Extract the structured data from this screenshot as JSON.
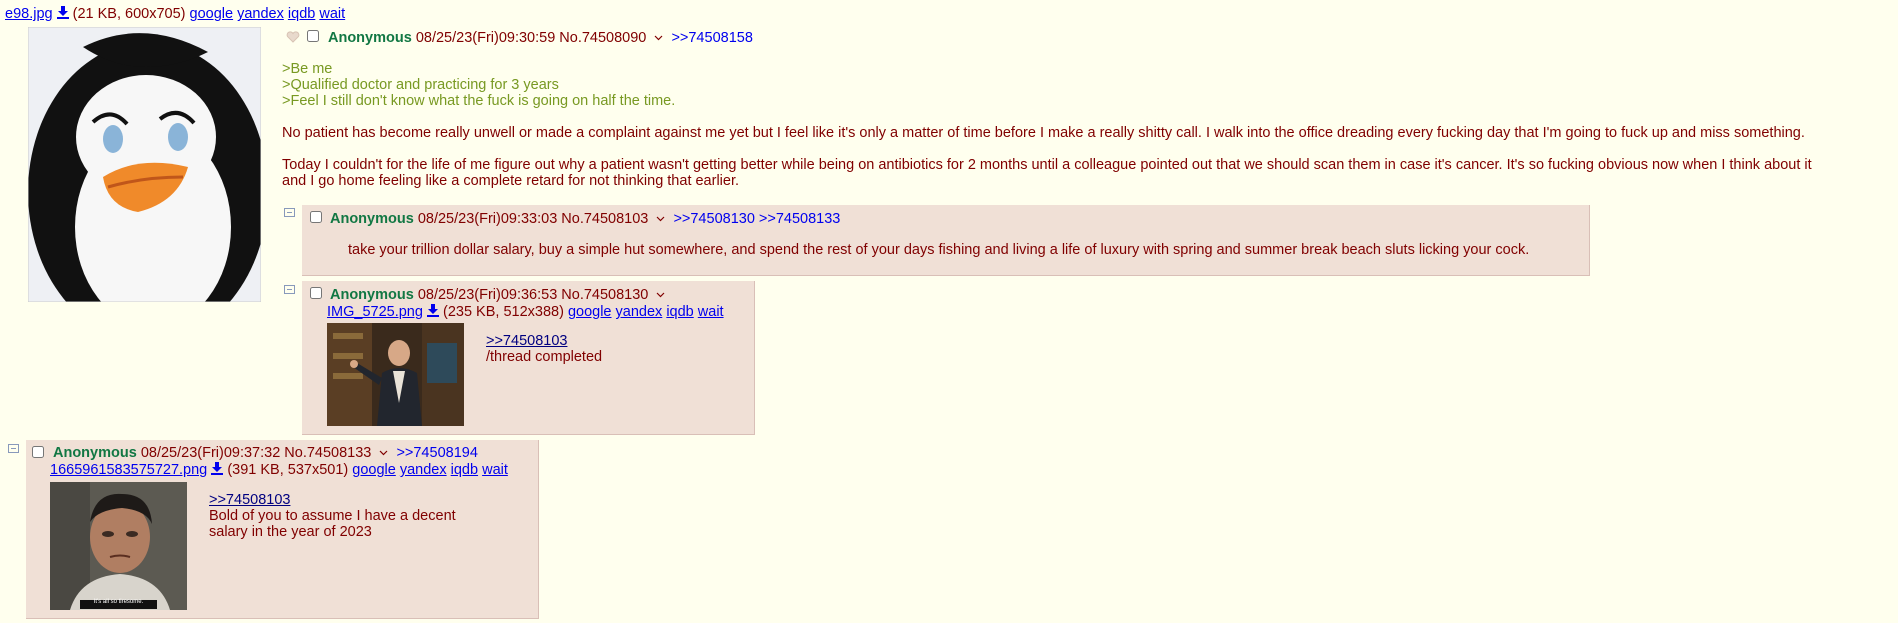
{
  "op": {
    "file": {
      "name": "e98.jpg",
      "info": "(21 KB, 600x705)"
    },
    "search_links": {
      "google": "google",
      "yandex": "yandex",
      "iqdb": "iqdb",
      "wait": "wait"
    },
    "name": "Anonymous",
    "datetime": "08/25/23(Fri)09:30:59",
    "post_no": "No.74508090",
    "backlinks": [
      ">>74508158"
    ],
    "quotes": [
      ">Be me",
      ">Qualified doctor and practicing for 3 years",
      ">Feel I still don't know what the fuck is going on half the time."
    ],
    "para1": "No patient has become really unwell or made a complaint against me yet but I feel like it's only a matter of time before I make a really shitty call. I walk into the office dreading every fucking day that I'm going to fuck up and miss something.",
    "para2_line1": "Today I couldn't for the life of me figure out why a patient wasn't getting better while being on antibiotics for 2 months until a colleague pointed out that we should scan them in case it's cancer. It's so fucking obvious now when I think about it",
    "para2_line2": "and I go home feeling like a complete retard for not thinking that earlier."
  },
  "reply1": {
    "name": "Anonymous",
    "datetime": "08/25/23(Fri)09:33:03",
    "post_no": "No.74508103",
    "backlinks": [
      ">>74508130",
      ">>74508133"
    ],
    "text": "take your trillion dollar salary, buy a simple hut somewhere, and spend the rest of your days fishing and living a life of luxury with spring and summer break beach sluts licking your cock."
  },
  "reply2": {
    "name": "Anonymous",
    "datetime": "08/25/23(Fri)09:36:53",
    "post_no": "No.74508130",
    "file": {
      "name": "IMG_5725.png",
      "info": "(235 KB, 512x388)"
    },
    "search_links": {
      "google": "google",
      "yandex": "yandex",
      "iqdb": "iqdb",
      "wait": "wait"
    },
    "quote_link": ">>74508103",
    "text": "/thread completed"
  },
  "reply3": {
    "name": "Anonymous",
    "datetime": "08/25/23(Fri)09:37:32",
    "post_no": "No.74508133",
    "backlinks": [
      ">>74508194"
    ],
    "file": {
      "name": "1665961583575727.png",
      "info": "(391 KB, 537x501)"
    },
    "search_links": {
      "google": "google",
      "yandex": "yandex",
      "iqdb": "iqdb",
      "wait": "wait"
    },
    "quote_link": ">>74508103",
    "text_line1": "Bold of you to assume I have a decent",
    "text_line2": "salary in the year of 2023",
    "thumb_caption": "It's all so tiresome."
  },
  "colors": {
    "background": "#ffffee",
    "reply_bg": "#f0e0d6",
    "name": "#117743",
    "greentext": "#789922",
    "text": "#800000",
    "link": "#0000ee"
  }
}
